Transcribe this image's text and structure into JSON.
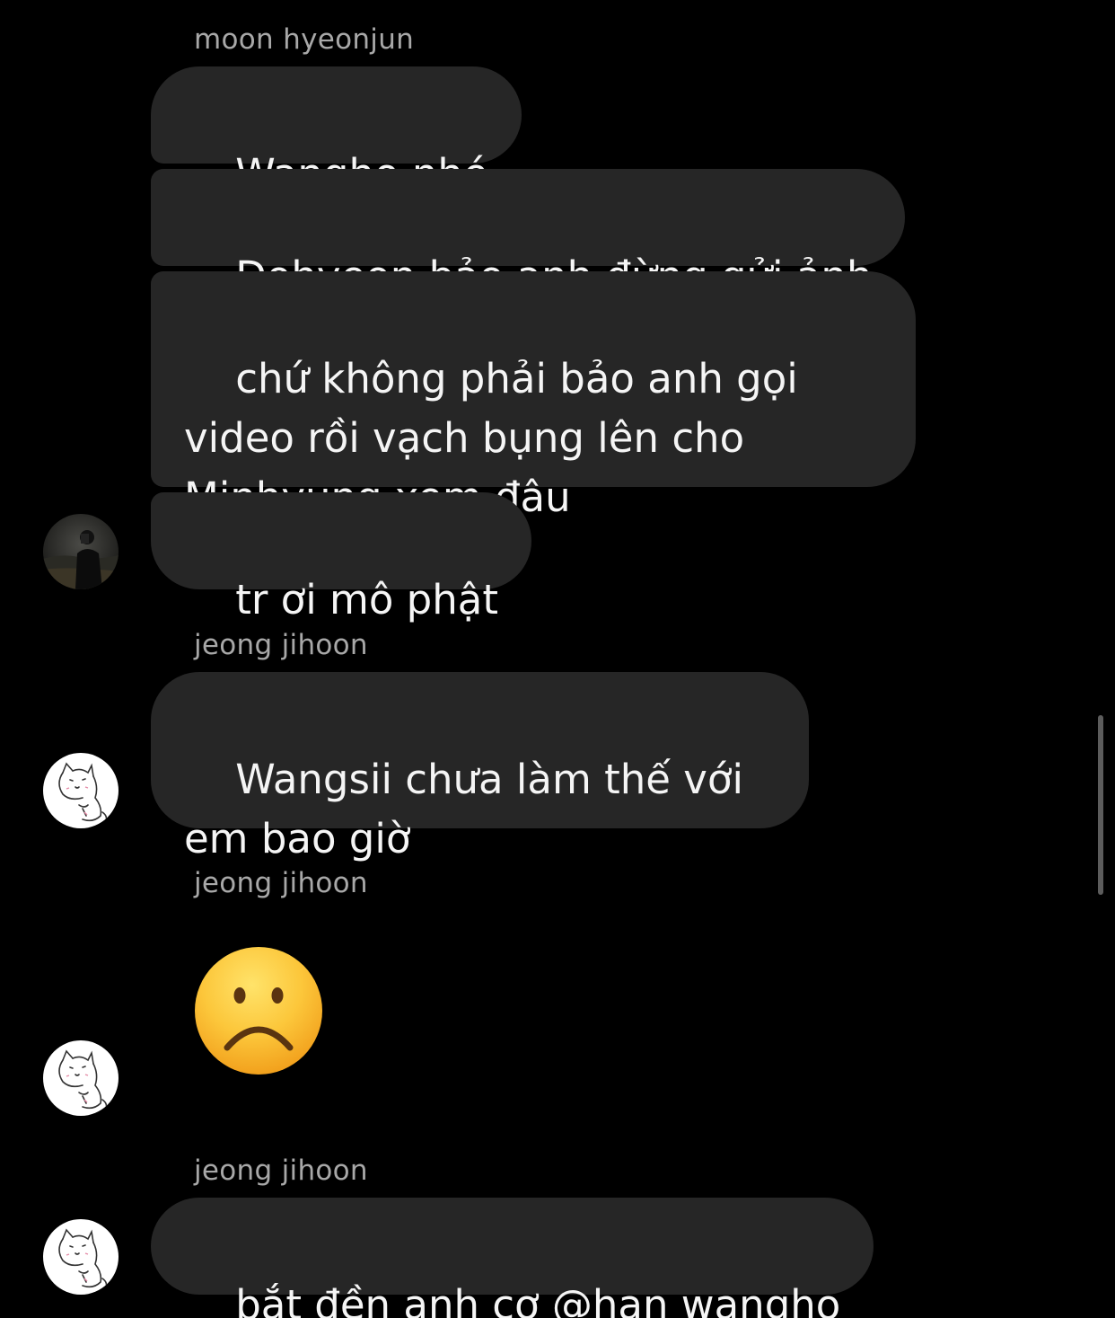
{
  "colors": {
    "background": "#000000",
    "bubble": "#262626",
    "bubble_text": "#f5f5f5",
    "sender_name": "#a8a8a8",
    "scrollbar": "#5c5c5c"
  },
  "conversation": {
    "groups": [
      {
        "sender": "moon hyeonjun",
        "avatar_icon": "user-photo-avatar",
        "messages": [
          "Wangho nhé",
          "Dohyeon bảo anh đừng gửi ảnh",
          "chứ không phải bảo anh gọi video rồi vạch bụng lên cho Minhyung xem đâu",
          "tr ơi mô phật"
        ]
      },
      {
        "sender": "jeong jihoon",
        "avatar_icon": "cat-drawing-avatar",
        "messages": [
          "Wangsii chưa làm thế với em bao giờ"
        ]
      },
      {
        "sender": "jeong jihoon",
        "avatar_icon": "cat-drawing-avatar",
        "emoji": "☹️",
        "emoji_icon": "frowning-face-emoji"
      },
      {
        "sender": "jeong jihoon",
        "avatar_icon": "cat-drawing-avatar",
        "messages": [
          "bắt đền anh cơ @han wangho"
        ]
      }
    ]
  }
}
